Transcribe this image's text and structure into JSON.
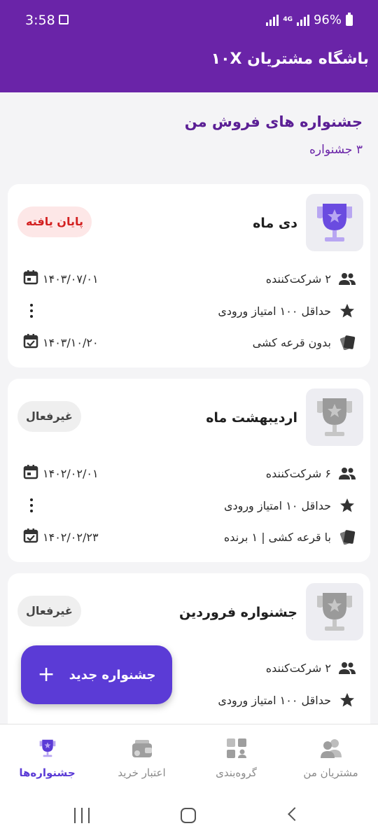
{
  "status_bar": {
    "time": "3:58",
    "network": "4G",
    "battery": "96%"
  },
  "app": {
    "title": "باشگاه مشتریان ۱۰X"
  },
  "page": {
    "title": "جشنواره های فروش من",
    "subtitle": "۳ جشنواره"
  },
  "festivals": [
    {
      "name": "دی ماه",
      "status": "پایان یافته",
      "participants": "۲ شرکت‌کننده",
      "min_points": "حداقل ۱۰۰ امتیاز ورودی",
      "lottery": "بدون قرعه کشی",
      "start_date": "۱۴۰۳/۰۷/۰۱",
      "end_date": "۱۴۰۳/۱۰/۲۰"
    },
    {
      "name": "اردیبهشت ماه",
      "status": "غیرفعال",
      "participants": "۶ شرکت‌کننده",
      "min_points": "حداقل ۱۰ امتیاز ورودی",
      "lottery": "با قرعه کشی | ۱ برنده",
      "start_date": "۱۴۰۲/۰۲/۰۱",
      "end_date": "۱۴۰۲/۰۲/۲۳"
    },
    {
      "name": "جشنواره فروردین",
      "status": "غیرفعال",
      "participants": "۲ شرکت‌کننده",
      "min_points": "حداقل ۱۰۰ امتیاز ورودی"
    }
  ],
  "fab": {
    "label": "جشنواره جدید",
    "icon": "plus-icon"
  },
  "bottom_nav": [
    {
      "label": "جشنواره‌ها",
      "icon": "trophy-icon",
      "active": true
    },
    {
      "label": "اعتبار خرید",
      "icon": "wallet-icon",
      "active": false
    },
    {
      "label": "گروه‌بندی",
      "icon": "grid-icon",
      "active": false
    },
    {
      "label": "مشتریان من",
      "icon": "users-icon",
      "active": false
    }
  ],
  "colors": {
    "primary": "#6a24a8",
    "accent": "#5b3bd6",
    "ended": "#d32020"
  }
}
